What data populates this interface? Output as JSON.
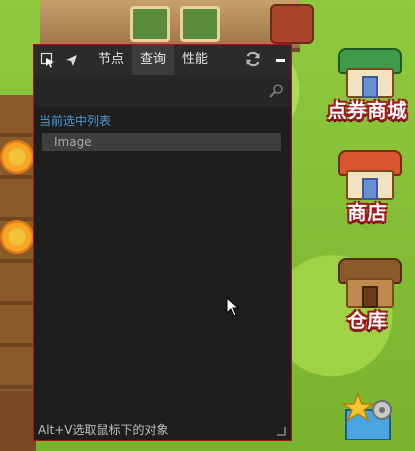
{
  "inspector": {
    "tabs": [
      {
        "label": "节点",
        "active": false
      },
      {
        "label": "查询",
        "active": true
      },
      {
        "label": "性能",
        "active": false
      }
    ],
    "search": {
      "value": "",
      "placeholder": ""
    },
    "section_title": "当前选中列表",
    "selected_items": [
      "Image"
    ],
    "footer_hint": "Alt+V选取鼠标下的对象"
  },
  "shop_buttons": [
    {
      "label": "点券商城",
      "roof_color": "#c9423a"
    },
    {
      "label": "商店",
      "roof_color": "#d9552e"
    },
    {
      "label": "仓库",
      "roof_color": "#8a5a2b"
    }
  ],
  "colors": {
    "panel_bg": "#1e1e1e",
    "panel_border": "#9b1a1a",
    "toolbar_bg": "#2b2b2b",
    "active_tab_bg": "#3c3c3c",
    "section_title": "#4a9ad8",
    "list_item_bg": "#3e3e3e"
  }
}
